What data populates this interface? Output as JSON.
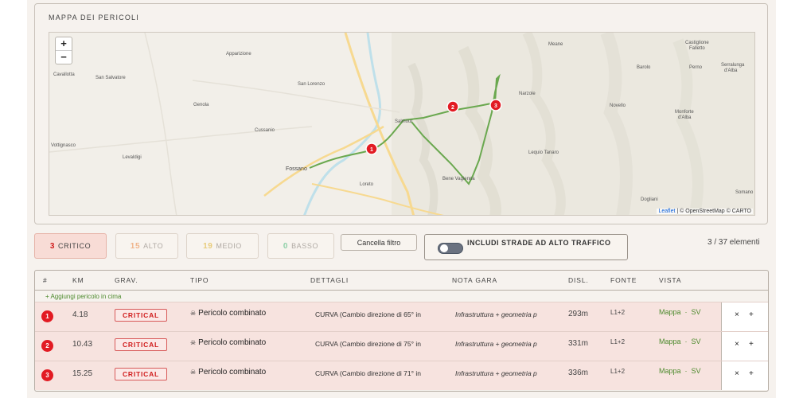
{
  "map": {
    "title": "MAPPA DEI PERICOLI",
    "zoom_in": "+",
    "zoom_out": "−",
    "attribution_leaflet": "Leaflet",
    "attribution_rest": " | © OpenStreetMap © CARTO",
    "towns": [
      "Cavallotta",
      "San Salvatore",
      "Apparizione",
      "San Lorenzo",
      "Genola",
      "Cussanio",
      "Vottignasco",
      "Levaldigi",
      "Fossano",
      "Loreto",
      "Salmour",
      "Bene Vagienna",
      "Narzole",
      "Meane",
      "Novello",
      "Barolo",
      "Perno",
      "Castiglione Falletto",
      "Serralunga d'Alba",
      "Monforte d'Alba",
      "Lequio Tanaro",
      "Dogliani",
      "Somano"
    ],
    "markers": [
      "1",
      "2",
      "3"
    ]
  },
  "filters": {
    "critico": {
      "count": "3",
      "label": "CRITICO"
    },
    "alto": {
      "count": "15",
      "label": "ALTO"
    },
    "medio": {
      "count": "19",
      "label": "MEDIO"
    },
    "basso": {
      "count": "0",
      "label": "BASSO"
    },
    "clear_label": "Cancella filtro",
    "traffic_label": "INCLUDI STRADE AD ALTO TRAFFICO",
    "traffic_on": false,
    "count_text": "3 / 37 elementi"
  },
  "table": {
    "headers": {
      "num": "#",
      "km": "KM",
      "grav": "GRAV.",
      "tipo": "TIPO",
      "dettagli": "DETTAGLI",
      "nota": "NOTA GARA",
      "disl": "DISL.",
      "fonte": "FONTE",
      "vista": "VISTA"
    },
    "add_label": "+ Aggiungi pericolo in cima",
    "rows": [
      {
        "num": "1",
        "km": "4.18",
        "grav": "CRITICAL",
        "tipo": "Pericolo combinato",
        "dettagli": "CURVA (Cambio direzione di 65° in",
        "nota": "Infrastruttura + geometria p",
        "disl": "293m",
        "fonte": "L1+2",
        "vista_map": "Mappa",
        "vista_sv": "SV",
        "del": "×",
        "add": "+"
      },
      {
        "num": "2",
        "km": "10.43",
        "grav": "CRITICAL",
        "tipo": "Pericolo combinato",
        "dettagli": "CURVA (Cambio direzione di 75° in",
        "nota": "Infrastruttura + geometria p",
        "disl": "331m",
        "fonte": "L1+2",
        "vista_map": "Mappa",
        "vista_sv": "SV",
        "del": "×",
        "add": "+"
      },
      {
        "num": "3",
        "km": "15.25",
        "grav": "CRITICAL",
        "tipo": "Pericolo combinato",
        "dettagli": "CURVA (Cambio direzione di 71° in",
        "nota": "Infrastruttura + geometria p",
        "disl": "336m",
        "fonte": "L1+2",
        "vista_map": "Mappa",
        "vista_sv": "SV",
        "del": "×",
        "add": "+"
      }
    ]
  },
  "colors": {
    "critical": "#e21b23",
    "route": "#6aa84f",
    "accent_green": "#4c8a2c"
  }
}
